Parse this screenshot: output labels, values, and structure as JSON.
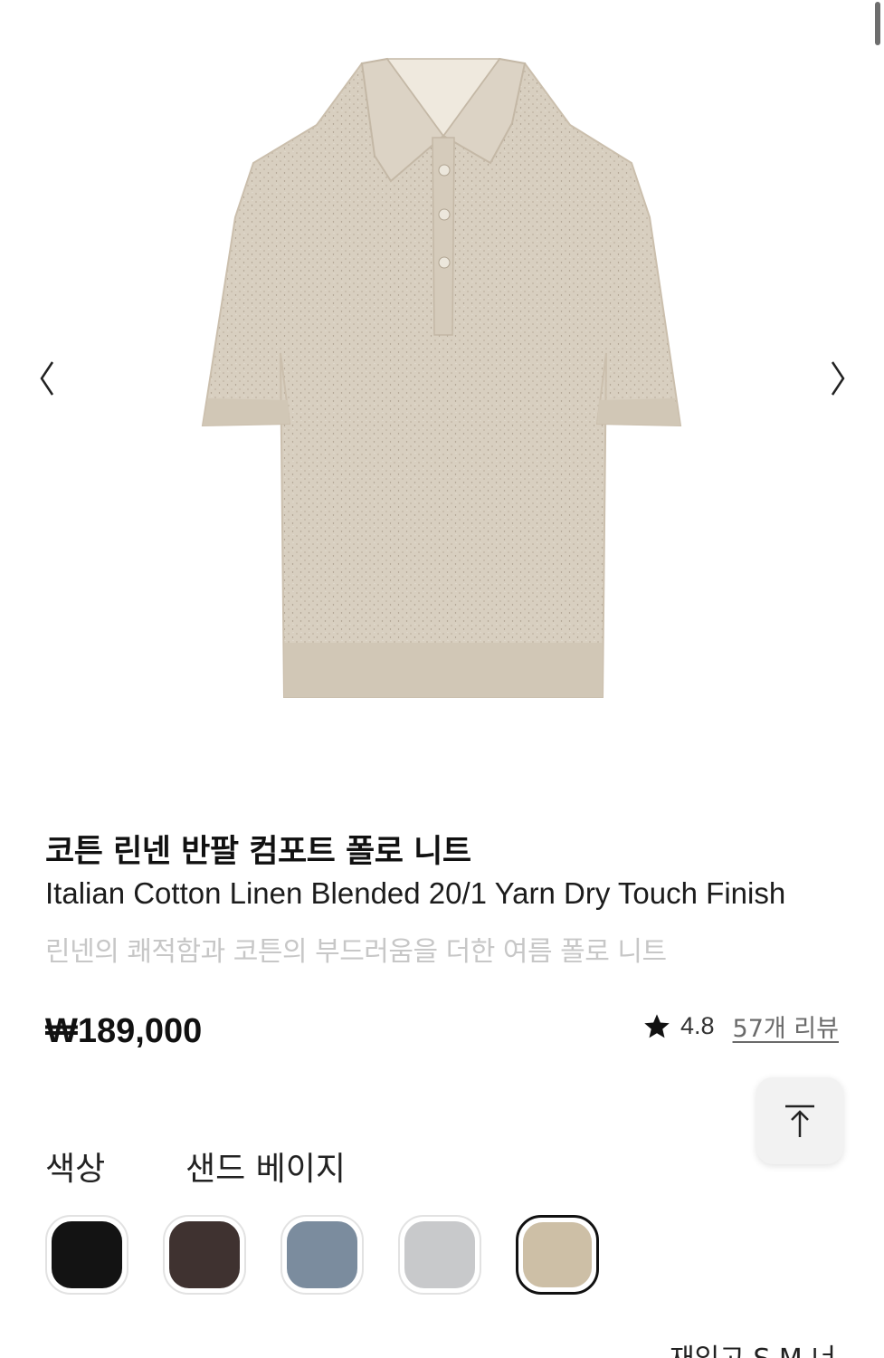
{
  "product": {
    "title_ko": "코튼 린넨 반팔 컴포트 폴로 니트",
    "title_en": "Italian Cotton Linen Blended 20/1 Yarn Dry Touch Finish",
    "subtitle": "린넨의 쾌적함과 코튼의 부드러움을 더한 여름 폴로 니트",
    "price": "₩189,000"
  },
  "rating": {
    "value": "4.8",
    "reviews_label": "57개 리뷰"
  },
  "color": {
    "label": "색상",
    "selected_name": "샌드 베이지",
    "swatches": [
      {
        "name": "black",
        "hex": "#131313"
      },
      {
        "name": "brown",
        "hex": "#3f3230"
      },
      {
        "name": "blue-grey",
        "hex": "#7b8c9e"
      },
      {
        "name": "light-grey",
        "hex": "#c8c9cb"
      },
      {
        "name": "sand-beige",
        "hex": "#cdbfa6",
        "selected": true
      }
    ]
  },
  "size_peek": "재입고 S   M   너",
  "icons": {
    "prev": "chevron-left-icon",
    "next": "chevron-right-icon",
    "star": "star-icon",
    "to_top": "arrow-up-to-top-icon"
  }
}
